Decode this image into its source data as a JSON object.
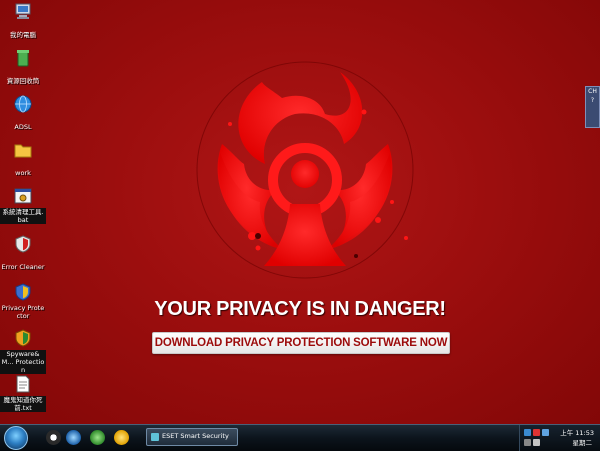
{
  "desktop": {
    "icons": [
      {
        "label": "我的電腦",
        "icon": "computer-icon"
      },
      {
        "label": "資源回收筒",
        "icon": "recycle-bin-icon"
      },
      {
        "label": "ADSL",
        "icon": "network-globe-icon"
      },
      {
        "label": "work",
        "icon": "folder-icon"
      },
      {
        "label": "系統清理工具.bat",
        "icon": "batch-file-icon"
      },
      {
        "label": "Error Cleaner",
        "icon": "shield-icon"
      },
      {
        "label": "Privacy Protector",
        "icon": "shield-icon"
      },
      {
        "label": "Spyware&M... Protection",
        "icon": "shield-icon"
      },
      {
        "label": "魔鬼知道你死前.txt",
        "icon": "text-file-icon"
      }
    ]
  },
  "edge_widget": {
    "line1": "CH",
    "line2": "?"
  },
  "main": {
    "headline": "YOUR PRIVACY IS IN DANGER!",
    "download_button": "DOWNLOAD PRIVACY PROTECTION SOFTWARE NOW"
  },
  "taskbar": {
    "task_label": "ESET Smart Security",
    "clock_time": "上午 11:53",
    "clock_day": "星期二"
  },
  "colors": {
    "background": "#9c0e0e",
    "hazard": "#ff1010",
    "button_text": "#9c0b0b"
  }
}
